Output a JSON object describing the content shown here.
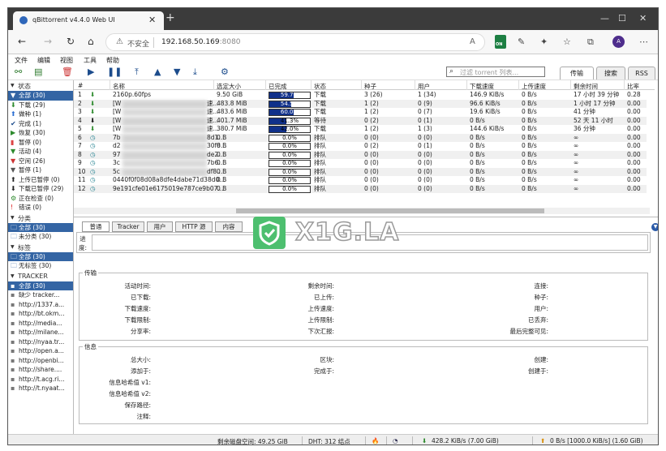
{
  "browser": {
    "tab_title": "qBittorrent v4.4.0 Web UI",
    "not_secure": "不安全",
    "url_host": "192.168.50.169",
    "url_port": ":8080",
    "on_badge": "ON",
    "avatar_initial": "A"
  },
  "menu": [
    "文件",
    "编辑",
    "视图",
    "工具",
    "帮助"
  ],
  "filter_placeholder": "过滤 torrent 列表...",
  "view_tabs": [
    "传输",
    "搜索",
    "RSS"
  ],
  "sidebar": {
    "status_header": "状态",
    "status_items": [
      {
        "label": "全部 (30)",
        "icon": "all-filter-icon",
        "glyph": "▼",
        "color": "#d88b00"
      },
      {
        "label": "下载 (29)",
        "icon": "download-arrow-icon",
        "glyph": "⬇",
        "color": "#2d8a2d"
      },
      {
        "label": "做种 (1)",
        "icon": "upload-arrow-icon",
        "glyph": "⬆",
        "color": "#2a6ed2"
      },
      {
        "label": "完成 (1)",
        "icon": "checkmark-icon",
        "glyph": "✔",
        "color": "#1c4c8c"
      },
      {
        "label": "恢复 (30)",
        "icon": "resume-icon",
        "glyph": "▶",
        "color": "#2d8a2d"
      },
      {
        "label": "暂停 (0)",
        "icon": "pause-icon",
        "glyph": "▮",
        "color": "#d44"
      },
      {
        "label": "活动 (4)",
        "icon": "active-filter-icon",
        "glyph": "▼",
        "color": "#2d8a2d"
      },
      {
        "label": "空闲 (26)",
        "icon": "inactive-filter-icon",
        "glyph": "▼",
        "color": "#c33"
      },
      {
        "label": "暂停 (1)",
        "icon": "stalled-filter-icon",
        "glyph": "▼",
        "color": "#555"
      },
      {
        "label": "上传已暂停 (0)",
        "icon": "upload-stalled-icon",
        "glyph": "⬆",
        "color": "#222"
      },
      {
        "label": "下载已暂停 (29)",
        "icon": "download-stalled-icon",
        "glyph": "⬇",
        "color": "#222"
      },
      {
        "label": "正在检查 (0)",
        "icon": "checking-icon",
        "glyph": "⚙",
        "color": "#2d8a2d"
      },
      {
        "label": "错误 (0)",
        "icon": "error-icon",
        "glyph": "!",
        "color": "#d22"
      }
    ],
    "category_header": "分类",
    "category_items": [
      {
        "label": "全部 (30)",
        "icon": "folder-icon"
      },
      {
        "label": "未分类 (30)",
        "icon": "folder-icon"
      }
    ],
    "tag_header": "标签",
    "tag_items": [
      {
        "label": "全部 (30)",
        "icon": "tag-folder-icon"
      },
      {
        "label": "无标签 (30)",
        "icon": "tag-folder-icon"
      }
    ],
    "tracker_header": "TRACKER",
    "tracker_items": [
      {
        "label": "全部 (30)"
      },
      {
        "label": "缺少 tracker..."
      },
      {
        "label": "http://1337.a..."
      },
      {
        "label": "http://bt.okm..."
      },
      {
        "label": "http://media..."
      },
      {
        "label": "http://milane..."
      },
      {
        "label": "http://nyaa.tr..."
      },
      {
        "label": "http://open.a..."
      },
      {
        "label": "http://openbi..."
      },
      {
        "label": "http://share...."
      },
      {
        "label": "http://t.acg.ri..."
      },
      {
        "label": "http://t.nyaat..."
      }
    ]
  },
  "list": {
    "headers": [
      "#",
      "名称",
      "选定大小",
      "已完成",
      "状态",
      "种子",
      "用户",
      "下载速度",
      "上传速度",
      "剩余时间",
      "比率"
    ],
    "rows": [
      {
        "n": "1",
        "icon": "down",
        "name": "2160p.60fps",
        "size": "9.50 GiB",
        "pct": "59.7%",
        "p": 0.597,
        "state": "下载",
        "seeds": "3 (26)",
        "peers": "1 (34)",
        "dl": "146.9 KiB/s",
        "ul": "0 B/s",
        "eta": "17 小时 39 分钟",
        "ratio": "0.28"
      },
      {
        "n": "2",
        "icon": "down",
        "name": "[W",
        "name_tail": "速...",
        "size": "483.8 MiB",
        "pct": "54.5%",
        "p": 0.545,
        "state": "下载",
        "seeds": "1 (2)",
        "peers": "0 (9)",
        "dl": "96.6 KiB/s",
        "ul": "0 B/s",
        "eta": "1 小时 17 分钟",
        "ratio": "0.00"
      },
      {
        "n": "3",
        "icon": "down",
        "name": "[W",
        "name_tail": "速...",
        "size": "483.6 MiB",
        "pct": "60.0%",
        "p": 0.6,
        "state": "下载",
        "seeds": "1 (2)",
        "peers": "0 (7)",
        "dl": "19.6 KiB/s",
        "ul": "0 B/s",
        "eta": "41 分钟",
        "ratio": "0.00"
      },
      {
        "n": "4",
        "icon": "down-dark",
        "name": "[W",
        "name_tail": "速...",
        "size": "401.7 MiB",
        "pct": "41.3%",
        "p": 0.413,
        "state": "等待",
        "seeds": "0 (2)",
        "peers": "0 (1)",
        "dl": "0 B/s",
        "ul": "0 B/s",
        "eta": "52 天 11 小时",
        "ratio": "0.00"
      },
      {
        "n": "5",
        "icon": "down",
        "name": "[W",
        "name_tail": "速...",
        "size": "380.7 MiB",
        "pct": "42.0%",
        "p": 0.42,
        "state": "下载",
        "seeds": "1 (2)",
        "peers": "1 (3)",
        "dl": "144.6 KiB/s",
        "ul": "0 B/s",
        "eta": "36 分钟",
        "ratio": "0.00"
      },
      {
        "n": "6",
        "icon": "queue",
        "name": "7b",
        "name_tail": "8d1...",
        "size": "0 B",
        "pct": "0.0%",
        "p": 0,
        "state": "排队",
        "seeds": "0 (0)",
        "peers": "0 (0)",
        "dl": "0 B/s",
        "ul": "0 B/s",
        "eta": "∞",
        "ratio": "0.00"
      },
      {
        "n": "7",
        "icon": "queue",
        "name": "d2",
        "name_tail": "30f8...",
        "size": "0 B",
        "pct": "0.0%",
        "p": 0,
        "state": "排队",
        "seeds": "0 (2)",
        "peers": "0 (1)",
        "dl": "0 B/s",
        "ul": "0 B/s",
        "eta": "∞",
        "ratio": "0.00"
      },
      {
        "n": "8",
        "icon": "queue",
        "name": "97",
        "name_tail": "de2...",
        "size": "0 B",
        "pct": "0.0%",
        "p": 0,
        "state": "排队",
        "seeds": "0 (0)",
        "peers": "0 (0)",
        "dl": "0 B/s",
        "ul": "0 B/s",
        "eta": "∞",
        "ratio": "0.00"
      },
      {
        "n": "9",
        "icon": "queue",
        "name": "3c",
        "name_tail": "7b6...",
        "size": "0 B",
        "pct": "0.0%",
        "p": 0,
        "state": "排队",
        "seeds": "0 (0)",
        "peers": "0 (0)",
        "dl": "0 B/s",
        "ul": "0 B/s",
        "eta": "∞",
        "ratio": "0.00"
      },
      {
        "n": "10",
        "icon": "queue",
        "name": "5c",
        "name_tail": "df8...",
        "size": "0 B",
        "pct": "0.0%",
        "p": 0,
        "state": "排队",
        "seeds": "0 (0)",
        "peers": "0 (0)",
        "dl": "0 B/s",
        "ul": "0 B/s",
        "eta": "∞",
        "ratio": "0.00"
      },
      {
        "n": "11",
        "icon": "queue",
        "name": "0440f0f08d08a8dfe4dabe71d38d0...",
        "size": "0 B",
        "pct": "0.0%",
        "p": 0,
        "state": "排队",
        "seeds": "0 (0)",
        "peers": "0 (0)",
        "dl": "0 B/s",
        "ul": "0 B/s",
        "eta": "∞",
        "ratio": "0.00"
      },
      {
        "n": "12",
        "icon": "queue",
        "name": "9e191cfe01e6175019e787ce9b07...",
        "size": "0 B",
        "pct": "0.0%",
        "p": 0,
        "state": "排队",
        "seeds": "0 (0)",
        "peers": "0 (0)",
        "dl": "0 B/s",
        "ul": "0 B/s",
        "eta": "∞",
        "ratio": "0.00"
      }
    ]
  },
  "props": {
    "tabs": [
      "普通",
      "Tracker",
      "用户",
      "HTTP 源",
      "内容"
    ],
    "progress_label": "进度:",
    "transfer_title": "传输",
    "transfer_fields": [
      [
        "活动时间:",
        "剩余时间:",
        "连接:"
      ],
      [
        "已下载:",
        "已上传:",
        "种子:"
      ],
      [
        "下载速度:",
        "上传速度:",
        "用户:"
      ],
      [
        "下载限制:",
        "上传限制:",
        "已丢弃:"
      ],
      [
        "分享率:",
        "下次汇报:",
        "最后完整可见:"
      ]
    ],
    "info_title": "信息",
    "info_fields": [
      [
        "总大小:",
        "区块:",
        "创建:"
      ],
      [
        "添加于:",
        "完成于:",
        "创建于:"
      ],
      [
        "信息哈希值 v1:",
        "",
        ""
      ],
      [
        "信息哈希值 v2:",
        "",
        ""
      ],
      [
        "保存路径:",
        "",
        ""
      ],
      [
        "注释:",
        "",
        ""
      ]
    ]
  },
  "status": {
    "disk": "剩余磁盘空间: 49.25 GiB",
    "dht": "DHT: 312 结点",
    "dl": "428.2 KiB/s (7.00 GiB)",
    "ul": "0 B/s [1000.0 KiB/s] (1.60 GiB)"
  },
  "watermark": "X1G.LA",
  "colors": {
    "accent": "#3465a4",
    "progress": "#10308a",
    "watermark": "#4dbf6f"
  }
}
